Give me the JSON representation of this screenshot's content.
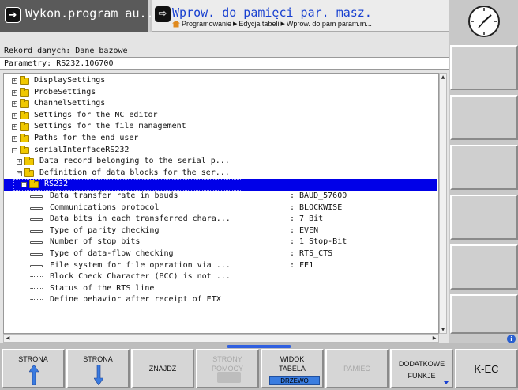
{
  "header": {
    "left_tab": {
      "icon": "arrow-right-icon",
      "title": "Wykon.program au..."
    },
    "right_tab": {
      "icon": "edit-arrow-icon",
      "title": "Wprow. do pamięci par. masz.",
      "breadcrumb": [
        "Programowanie",
        "Edycja tabeli",
        "Wprow. do pam param.m..."
      ]
    },
    "clock_icon": "clock-icon"
  },
  "main": {
    "record_label": "Rekord danych: Dane bazowe",
    "params_label": "Parametry: RS232.106700"
  },
  "tree": {
    "rows": [
      {
        "label": "DisplaySettings",
        "value": ""
      },
      {
        "label": "ProbeSettings",
        "value": ""
      },
      {
        "label": "ChannelSettings",
        "value": ""
      },
      {
        "label": "Settings for the NC editor",
        "value": ""
      },
      {
        "label": "Settings for the file management",
        "value": ""
      },
      {
        "label": "Paths for the end user",
        "value": ""
      },
      {
        "label": "serialInterfaceRS232",
        "value": ""
      },
      {
        "label": "Data record belonging to the serial p...",
        "value": ""
      },
      {
        "label": "Definition of data blocks for the ser...",
        "value": ""
      },
      {
        "label": "RS232",
        "value": ""
      },
      {
        "label": "Data transfer rate in bauds",
        "value": ": BAUD_57600"
      },
      {
        "label": "Communications protocol",
        "value": ": BLOCKWISE"
      },
      {
        "label": "Data bits in each transferred chara...",
        "value": ": 7 Bit"
      },
      {
        "label": "Type of parity checking",
        "value": ": EVEN"
      },
      {
        "label": "Number of stop bits",
        "value": ": 1 Stop-Bit"
      },
      {
        "label": "Type of data-flow checking",
        "value": ": RTS_CTS"
      },
      {
        "label": "File system for file operation via ...",
        "value": ": FE1"
      },
      {
        "label": "Block Check Character (BCC) is not ...",
        "value": ""
      },
      {
        "label": "Status of the RTS line",
        "value": ""
      },
      {
        "label": "Define behavior after receipt of ETX",
        "value": ""
      }
    ]
  },
  "softkeys": {
    "page_up": {
      "line1": "STRONA",
      "icon": "arrow-up-icon"
    },
    "page_down": {
      "line1": "STRONA",
      "icon": "arrow-down-icon"
    },
    "find": {
      "line1": "ZNAJDZ"
    },
    "help": {
      "line1": "STRONY",
      "line2": "POMOCY"
    },
    "view": {
      "line1": "WIDOK",
      "line2": "TABELA",
      "tag": "DRZEWO"
    },
    "memory": {
      "line1": "PAMIEC"
    },
    "extra": {
      "line1": "DODATKOWE",
      "line2": "FUNKJE"
    },
    "kec": {
      "line1": "K-EC"
    }
  },
  "colors": {
    "selection": "#0000e8",
    "title_blue": "#1840d0",
    "folder": "#f0c800"
  }
}
